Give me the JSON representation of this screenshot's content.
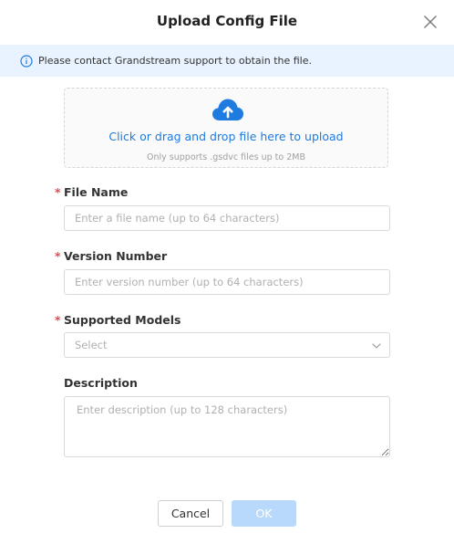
{
  "dialog": {
    "title": "Upload Config File"
  },
  "notice": {
    "text": "Please contact Grandstream support to obtain the file.",
    "icon": "info-icon",
    "background": "#e8f3ff"
  },
  "upload": {
    "icon": "cloud-upload-icon",
    "main_text": "Click or drag and drop file here to upload",
    "hint_text": "Only supports .gsdvc files up to 2MB"
  },
  "form": {
    "file_name": {
      "required_mark": "*",
      "label": "File Name",
      "placeholder": "Enter a file name (up to 64 characters)"
    },
    "version_number": {
      "required_mark": "*",
      "label": "Version Number",
      "placeholder": "Enter version number (up to 64 characters)"
    },
    "supported_models": {
      "required_mark": "*",
      "label": "Supported Models",
      "placeholder": "Select"
    },
    "description": {
      "label": "Description",
      "placeholder": "Enter description (up to 128 characters)"
    }
  },
  "buttons": {
    "cancel": "Cancel",
    "ok": "OK"
  },
  "colors": {
    "accent": "#1e7be0",
    "required": "#e5484d",
    "ok_disabled": "#b8d9fb"
  }
}
